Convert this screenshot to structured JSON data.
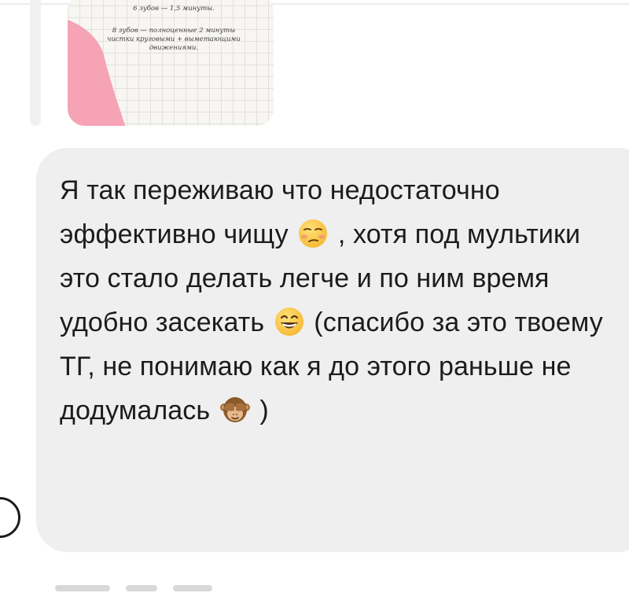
{
  "thread": {
    "attachment": {
      "line1": "6 зубов — 1,5 минуты.",
      "line2": "8 зубов — полноценные 2 минуты чистки круговыми + выметающими движениями.",
      "accent_color": "#f5a3b5",
      "grid_color": "#e3e1dd"
    },
    "message": {
      "part1": "Я так переживаю что недостаточно эффективно чищу",
      "emoji1": "unamused-face-icon",
      "part2": ", хотя под мультики это стало делать легче и по ним время удобно засекать",
      "emoji2": "grinning-face-icon",
      "part3": " (спасибо за это твоему ТГ, не понимаю как я до этого раньше не додумалась",
      "emoji3": "see-no-evil-monkey-icon",
      "part4": ")",
      "bubble_color": "#efefef",
      "text_color": "#1c1c1c"
    }
  }
}
